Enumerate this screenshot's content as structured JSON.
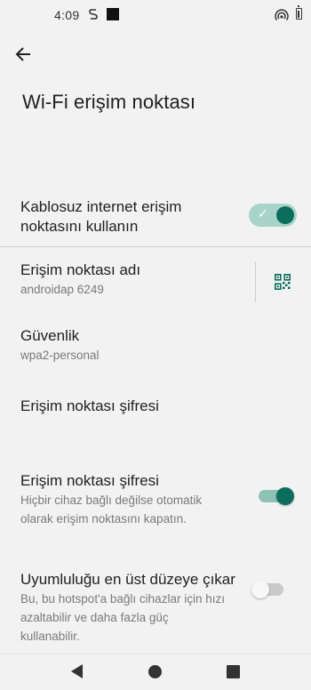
{
  "status_bar": {
    "time": "4:09",
    "icons": [
      "s-glyph-icon",
      "square-notification-icon",
      "hotspot-icon",
      "battery-icon"
    ]
  },
  "header": {
    "back_icon": "arrow-left-icon",
    "title": "Wi-Fi erişim noktası"
  },
  "settings": {
    "use_hotspot": {
      "title_line1": "Kablosuz internet erişim",
      "title_line2": "noktasını kullanın",
      "enabled": true
    },
    "hotspot_name": {
      "title": "Erişim noktası adı",
      "value": "androidap 6249",
      "action_icon": "qr-code-icon"
    },
    "security": {
      "title": "Güvenlik",
      "value": "wpa2-personal"
    },
    "password": {
      "title": "Erişim noktası şifresi"
    },
    "auto_off": {
      "title": "Erişim noktası şifresi",
      "desc_line1": "Hiçbir cihaz bağlı değilse otomatik",
      "desc_line2": "olarak erişim noktasını kapatın.",
      "enabled": true
    },
    "max_compat": {
      "title": "Uyumluluğu en üst düzeye çıkar",
      "desc_line1": "Bu, bu hotspot'a bağlı cihazlar için hızı",
      "desc_line2": "azaltabilir ve daha fazla güç",
      "desc_line3": "kullanabilir.",
      "enabled": false
    }
  },
  "colors": {
    "accent": "#0b6e5c",
    "accent_track": "#a8d3c9",
    "background": "#f2f2f2"
  },
  "nav_bar": {
    "icons": [
      "back-triangle-icon",
      "home-circle-icon",
      "recents-square-icon"
    ]
  }
}
